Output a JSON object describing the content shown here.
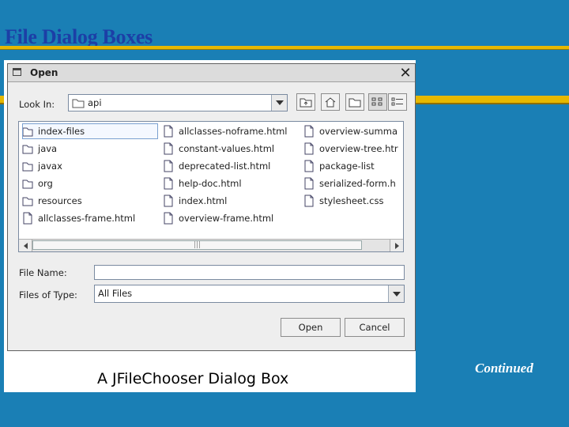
{
  "slide": {
    "title": "File Dialog Boxes",
    "continued": "Continued",
    "caption": "A JFileChooser Dialog Box",
    "colors": {
      "background": "#1a7fb5",
      "accent_line": "#e6b800",
      "title": "#1c3fa6"
    }
  },
  "dialog": {
    "title": "Open",
    "look_in_label": "Look In:",
    "look_in_value": "api",
    "toolbar_icons": [
      "up-folder-icon",
      "home-icon",
      "new-folder-icon",
      "list-view-icon",
      "details-view-icon"
    ],
    "files": [
      {
        "name": "index-files",
        "type": "folder",
        "selected": true
      },
      {
        "name": "java",
        "type": "folder"
      },
      {
        "name": "javax",
        "type": "folder"
      },
      {
        "name": "org",
        "type": "folder"
      },
      {
        "name": "resources",
        "type": "folder"
      },
      {
        "name": "allclasses-frame.html",
        "type": "file"
      },
      {
        "name": "allclasses-noframe.html",
        "type": "file"
      },
      {
        "name": "constant-values.html",
        "type": "file"
      },
      {
        "name": "deprecated-list.html",
        "type": "file"
      },
      {
        "name": "help-doc.html",
        "type": "file"
      },
      {
        "name": "index.html",
        "type": "file"
      },
      {
        "name": "overview-frame.html",
        "type": "file"
      },
      {
        "name": "overview-summa",
        "type": "file"
      },
      {
        "name": "overview-tree.htr",
        "type": "file"
      },
      {
        "name": "package-list",
        "type": "file"
      },
      {
        "name": "serialized-form.h",
        "type": "file"
      },
      {
        "name": "stylesheet.css",
        "type": "file"
      }
    ],
    "file_name_label": "File Name:",
    "file_name_value": "",
    "files_of_type_label": "Files of Type:",
    "files_of_type_value": "All Files",
    "open_button": "Open",
    "cancel_button": "Cancel"
  }
}
